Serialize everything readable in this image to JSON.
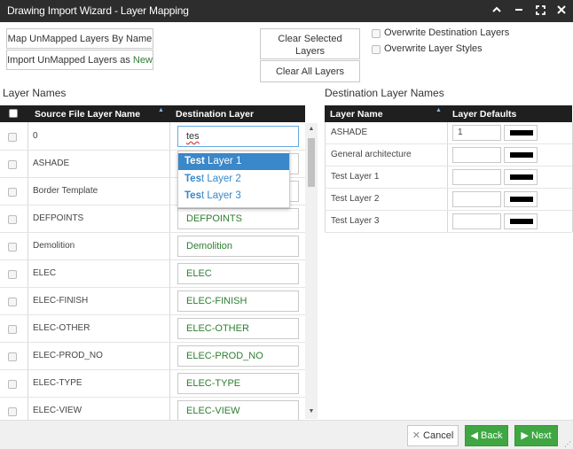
{
  "window": {
    "title": "Drawing Import Wizard - Layer Mapping",
    "controls": {
      "collapse": "chevron-up",
      "minimize": "minus",
      "maximize": "expand",
      "close": "x"
    }
  },
  "toolbar": {
    "map_unmapped": "Map UnMapped Layers By Name",
    "import_unmapped_prefix": "Import UnMapped Layers as",
    "import_unmapped_new": "New",
    "clear_selected_line1": "Clear Selected",
    "clear_selected_line2": "Layers",
    "clear_all": "Clear All Layers",
    "overwrite_dest": "Overwrite Destination Layers",
    "overwrite_styles": "Overwrite Layer Styles"
  },
  "left_grid": {
    "title": "Layer Names",
    "col_source": "Source File Layer Name",
    "col_dest": "Destination Layer",
    "rows": [
      {
        "source": "0",
        "dest": "tes"
      },
      {
        "source": "ASHADE",
        "dest": ""
      },
      {
        "source": "Border Template",
        "dest": ""
      },
      {
        "source": "DEFPOINTS",
        "dest": "DEFPOINTS"
      },
      {
        "source": "Demolition",
        "dest": "Demolition"
      },
      {
        "source": "ELEC",
        "dest": "ELEC"
      },
      {
        "source": "ELEC-FINISH",
        "dest": "ELEC-FINISH"
      },
      {
        "source": "ELEC-OTHER",
        "dest": "ELEC-OTHER"
      },
      {
        "source": "ELEC-PROD_NO",
        "dest": "ELEC-PROD_NO"
      },
      {
        "source": "ELEC-TYPE",
        "dest": "ELEC-TYPE"
      },
      {
        "source": "ELEC-VIEW",
        "dest": "ELEC-VIEW"
      }
    ]
  },
  "autocomplete": {
    "items": [
      {
        "match": "Test",
        "rest": " Layer 1",
        "selected": true
      },
      {
        "match": "Tes",
        "rest": "t Layer 2",
        "selected": false
      },
      {
        "match": "Tes",
        "rest": "t Layer 3",
        "selected": false
      }
    ]
  },
  "right_grid": {
    "title": "Destination Layer Names",
    "col_layer": "Layer Name",
    "col_defaults": "Layer Defaults",
    "rows": [
      {
        "name": "ASHADE",
        "default": "1",
        "color": "#000000"
      },
      {
        "name": "General architecture",
        "default": "",
        "color": "#000000"
      },
      {
        "name": "Test Layer 1",
        "default": "",
        "color": "#000000"
      },
      {
        "name": "Test Layer 2",
        "default": "",
        "color": "#000000"
      },
      {
        "name": "Test Layer 3",
        "default": "",
        "color": "#000000"
      }
    ]
  },
  "footer": {
    "cancel": "Cancel",
    "back": "Back",
    "next": "Next"
  },
  "colors": {
    "accent": "#3a87c9",
    "green": "#3fa742",
    "title_bg": "#2d2d2d",
    "new_text": "#2e7d32"
  }
}
